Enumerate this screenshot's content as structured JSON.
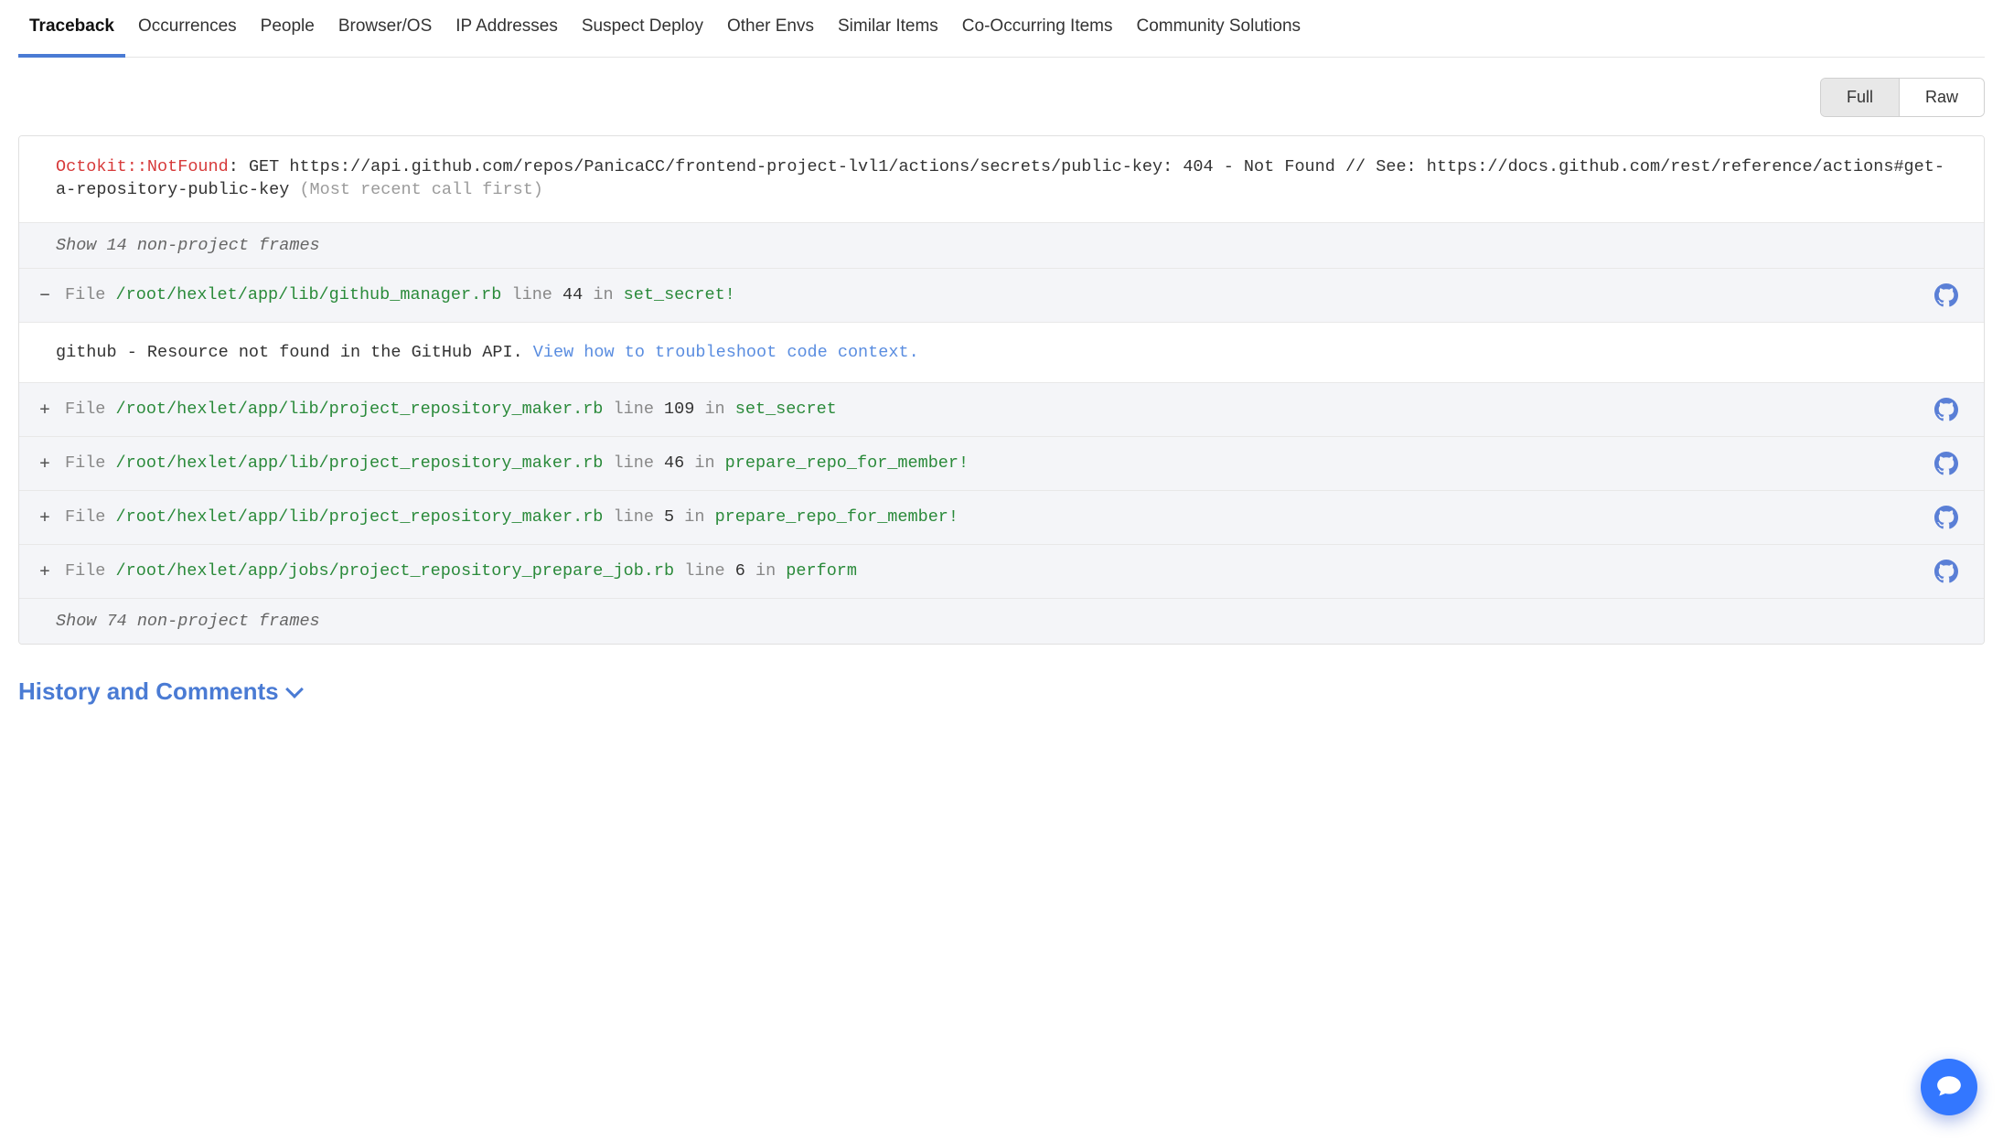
{
  "tabs": [
    {
      "label": "Traceback",
      "active": true
    },
    {
      "label": "Occurrences"
    },
    {
      "label": "People"
    },
    {
      "label": "Browser/OS"
    },
    {
      "label": "IP Addresses"
    },
    {
      "label": "Suspect Deploy"
    },
    {
      "label": "Other Envs"
    },
    {
      "label": "Similar Items"
    },
    {
      "label": "Co-Occurring Items"
    },
    {
      "label": "Community Solutions"
    }
  ],
  "view_toggle": {
    "full": "Full",
    "raw": "Raw",
    "active": "Full"
  },
  "error": {
    "name": "Octokit::NotFound",
    "sep": ": ",
    "message": "GET https://api.github.com/repos/PanicaCC/frontend-project-lvl1/actions/secrets/public-key: 404 - Not Found // See: https://docs.github.com/rest/reference/actions#get-a-repository-public-key ",
    "note": "(Most recent call first)"
  },
  "hidden_before": "Show 14 non-project frames",
  "hidden_after": "Show 74 non-project frames",
  "labels": {
    "file": "File ",
    "line": " line ",
    "in": " in "
  },
  "frames": [
    {
      "expanded": true,
      "path": "/root/hexlet/app/lib/github_manager.rb",
      "line": "44",
      "method": "set_secret!",
      "body_text": "github - Resource not found in the GitHub API.  ",
      "body_link": "View how to troubleshoot code context."
    },
    {
      "expanded": false,
      "path": "/root/hexlet/app/lib/project_repository_maker.rb",
      "line": "109",
      "method": "set_secret"
    },
    {
      "expanded": false,
      "path": "/root/hexlet/app/lib/project_repository_maker.rb",
      "line": "46",
      "method": "prepare_repo_for_member!"
    },
    {
      "expanded": false,
      "path": "/root/hexlet/app/lib/project_repository_maker.rb",
      "line": "5",
      "method": "prepare_repo_for_member!"
    },
    {
      "expanded": false,
      "path": "/root/hexlet/app/jobs/project_repository_prepare_job.rb",
      "line": "6",
      "method": "perform"
    }
  ],
  "history_section": "History and Comments"
}
